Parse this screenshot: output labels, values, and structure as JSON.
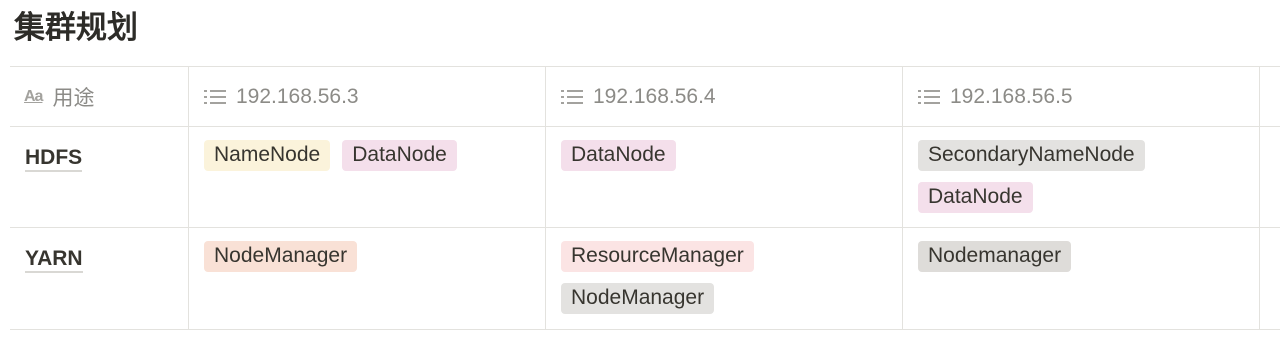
{
  "page": {
    "title": "集群规划"
  },
  "table": {
    "columns": [
      "用途",
      "192.168.56.3",
      "192.168.56.4",
      "192.168.56.5"
    ],
    "rows": [
      {
        "name": "HDFS",
        "cells": [
          [
            {
              "label": "NameNode",
              "color": "#fbf3db"
            },
            {
              "label": "DataNode",
              "color": "#f4dfeb"
            }
          ],
          [
            {
              "label": "DataNode",
              "color": "#f4dfeb"
            }
          ],
          [
            {
              "label": "SecondaryNameNode",
              "color": "#e3e2e0"
            },
            {
              "label": "DataNode",
              "color": "#f4dfeb"
            }
          ]
        ]
      },
      {
        "name": "YARN",
        "cells": [
          [
            {
              "label": "NodeManager",
              "color": "#f9e1d6"
            }
          ],
          [
            {
              "label": "ResourceManager",
              "color": "#fbe4e4"
            },
            {
              "label": "NodeManager",
              "color": "#e3e2e0"
            }
          ],
          [
            {
              "label": "Nodemanager",
              "color": "#dedcd9"
            }
          ]
        ]
      }
    ]
  },
  "icons": {
    "title_property": "text-property-icon",
    "multi_select": "list-icon"
  }
}
